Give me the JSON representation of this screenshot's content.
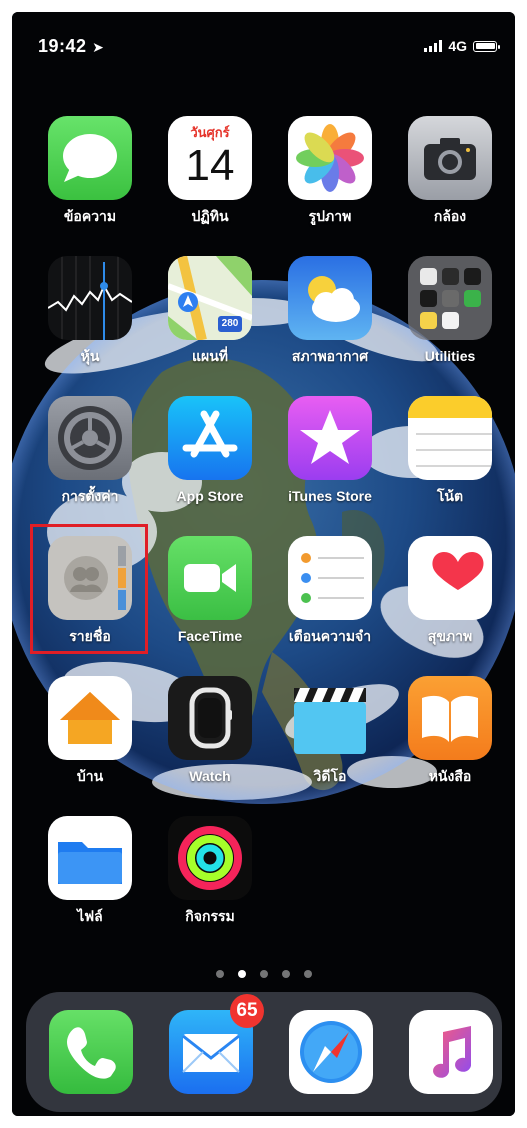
{
  "status_bar": {
    "time": "19:42",
    "network": "4G"
  },
  "apps": [
    {
      "id": "messages",
      "label": "ข้อความ",
      "icon": "messages-icon"
    },
    {
      "id": "calendar",
      "label": "ปฏิทิน",
      "icon": "calendar-icon",
      "day_name": "วันศุกร์",
      "day_number": "14"
    },
    {
      "id": "photos",
      "label": "รูปภาพ",
      "icon": "photos-icon"
    },
    {
      "id": "camera",
      "label": "กล้อง",
      "icon": "camera-icon"
    },
    {
      "id": "stocks",
      "label": "หุ้น",
      "icon": "stocks-icon"
    },
    {
      "id": "maps",
      "label": "แผนที่",
      "icon": "maps-icon",
      "route_number": "280"
    },
    {
      "id": "weather",
      "label": "สภาพอากาศ",
      "icon": "weather-icon"
    },
    {
      "id": "utilities",
      "label": "Utilities",
      "icon": "folder-icon"
    },
    {
      "id": "settings",
      "label": "การตั้งค่า",
      "icon": "settings-gear-icon"
    },
    {
      "id": "appstore",
      "label": "App Store",
      "icon": "app-store-icon"
    },
    {
      "id": "itunes",
      "label": "iTunes Store",
      "icon": "star-icon"
    },
    {
      "id": "notes",
      "label": "โน้ต",
      "icon": "notes-icon"
    },
    {
      "id": "contacts",
      "label": "รายชื่อ",
      "icon": "contacts-icon"
    },
    {
      "id": "facetime",
      "label": "FaceTime",
      "icon": "video-camera-icon"
    },
    {
      "id": "reminders",
      "label": "เตือนความจำ",
      "icon": "reminders-icon"
    },
    {
      "id": "health",
      "label": "สุขภาพ",
      "icon": "heart-icon"
    },
    {
      "id": "home",
      "label": "บ้าน",
      "icon": "house-icon"
    },
    {
      "id": "watch",
      "label": "Watch",
      "icon": "watch-icon"
    },
    {
      "id": "videos",
      "label": "วิดีโอ",
      "icon": "clapperboard-icon"
    },
    {
      "id": "books",
      "label": "หนังสือ",
      "icon": "open-book-icon"
    },
    {
      "id": "files",
      "label": "ไฟล์",
      "icon": "folder-blue-icon"
    },
    {
      "id": "activity",
      "label": "กิจกรรม",
      "icon": "activity-rings-icon"
    }
  ],
  "dock": [
    {
      "id": "phone",
      "icon": "phone-icon"
    },
    {
      "id": "mail",
      "icon": "mail-icon",
      "badge": "65"
    },
    {
      "id": "safari",
      "icon": "compass-icon"
    },
    {
      "id": "music",
      "icon": "music-note-icon"
    }
  ],
  "page_indicator": {
    "pages": 5,
    "current": 2
  },
  "highlight": {
    "target": "contacts",
    "color": "#e01e26"
  }
}
